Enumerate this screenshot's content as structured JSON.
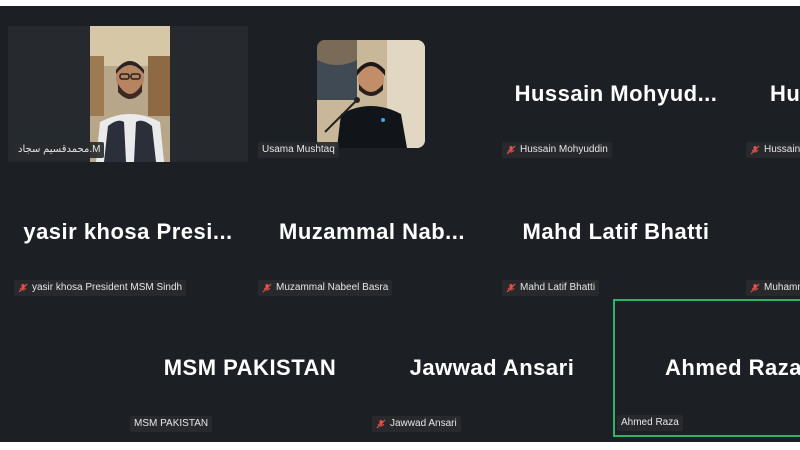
{
  "meeting": {
    "tiles": [
      {
        "big": "",
        "tag": "محمدقسیم سجاد.M",
        "muted": false,
        "video": "man-with-glasses"
      },
      {
        "big": "",
        "tag": "Usama Mushtaq",
        "muted": false,
        "video": "man-speaking-mic"
      },
      {
        "big": "Hussain  Mohyud...",
        "tag": "Hussain Mohyuddin",
        "muted": true
      },
      {
        "big": "Hu",
        "tag": "Hussain N",
        "muted": true
      },
      {
        "big": "yasir  khosa  Presi...",
        "tag": "yasir khosa President MSM Sindh",
        "muted": true
      },
      {
        "big": "Muzammal  Nab...",
        "tag": "Muzammal Nabeel Basra",
        "muted": true
      },
      {
        "big": "Mahd Latif Bhatti",
        "tag": "Mahd Latif Bhatti",
        "muted": true
      },
      {
        "big": "",
        "tag": "Muhamma",
        "muted": true
      },
      {
        "big": "MSM PAKISTAN",
        "tag": "MSM PAKISTAN",
        "muted": false
      },
      {
        "big": "Jawwad Ansari",
        "tag": "Jawwad Ansari",
        "muted": true
      },
      {
        "big": "Ahmed Raza",
        "tag": "Ahmed Raza",
        "muted": false,
        "active": true
      }
    ]
  },
  "colors": {
    "background": "#1c1f24",
    "active_border": "#2fb36b",
    "mute_icon": "#e0524a"
  }
}
